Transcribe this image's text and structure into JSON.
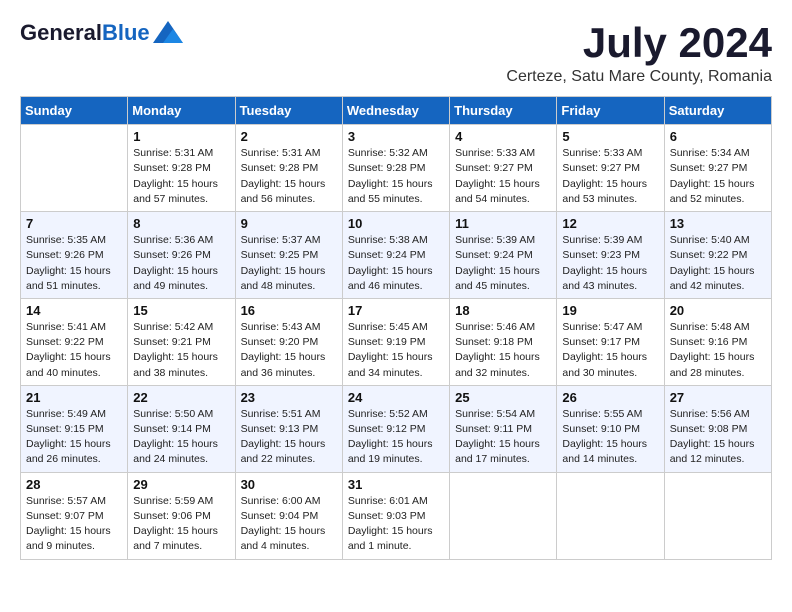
{
  "logo": {
    "general": "General",
    "blue": "Blue"
  },
  "title": {
    "month": "July 2024",
    "location": "Certeze, Satu Mare County, Romania"
  },
  "weekdays": [
    "Sunday",
    "Monday",
    "Tuesday",
    "Wednesday",
    "Thursday",
    "Friday",
    "Saturday"
  ],
  "weeks": [
    [
      {
        "day": "",
        "info": ""
      },
      {
        "day": "1",
        "info": "Sunrise: 5:31 AM\nSunset: 9:28 PM\nDaylight: 15 hours\nand 57 minutes."
      },
      {
        "day": "2",
        "info": "Sunrise: 5:31 AM\nSunset: 9:28 PM\nDaylight: 15 hours\nand 56 minutes."
      },
      {
        "day": "3",
        "info": "Sunrise: 5:32 AM\nSunset: 9:28 PM\nDaylight: 15 hours\nand 55 minutes."
      },
      {
        "day": "4",
        "info": "Sunrise: 5:33 AM\nSunset: 9:27 PM\nDaylight: 15 hours\nand 54 minutes."
      },
      {
        "day": "5",
        "info": "Sunrise: 5:33 AM\nSunset: 9:27 PM\nDaylight: 15 hours\nand 53 minutes."
      },
      {
        "day": "6",
        "info": "Sunrise: 5:34 AM\nSunset: 9:27 PM\nDaylight: 15 hours\nand 52 minutes."
      }
    ],
    [
      {
        "day": "7",
        "info": "Sunrise: 5:35 AM\nSunset: 9:26 PM\nDaylight: 15 hours\nand 51 minutes."
      },
      {
        "day": "8",
        "info": "Sunrise: 5:36 AM\nSunset: 9:26 PM\nDaylight: 15 hours\nand 49 minutes."
      },
      {
        "day": "9",
        "info": "Sunrise: 5:37 AM\nSunset: 9:25 PM\nDaylight: 15 hours\nand 48 minutes."
      },
      {
        "day": "10",
        "info": "Sunrise: 5:38 AM\nSunset: 9:24 PM\nDaylight: 15 hours\nand 46 minutes."
      },
      {
        "day": "11",
        "info": "Sunrise: 5:39 AM\nSunset: 9:24 PM\nDaylight: 15 hours\nand 45 minutes."
      },
      {
        "day": "12",
        "info": "Sunrise: 5:39 AM\nSunset: 9:23 PM\nDaylight: 15 hours\nand 43 minutes."
      },
      {
        "day": "13",
        "info": "Sunrise: 5:40 AM\nSunset: 9:22 PM\nDaylight: 15 hours\nand 42 minutes."
      }
    ],
    [
      {
        "day": "14",
        "info": "Sunrise: 5:41 AM\nSunset: 9:22 PM\nDaylight: 15 hours\nand 40 minutes."
      },
      {
        "day": "15",
        "info": "Sunrise: 5:42 AM\nSunset: 9:21 PM\nDaylight: 15 hours\nand 38 minutes."
      },
      {
        "day": "16",
        "info": "Sunrise: 5:43 AM\nSunset: 9:20 PM\nDaylight: 15 hours\nand 36 minutes."
      },
      {
        "day": "17",
        "info": "Sunrise: 5:45 AM\nSunset: 9:19 PM\nDaylight: 15 hours\nand 34 minutes."
      },
      {
        "day": "18",
        "info": "Sunrise: 5:46 AM\nSunset: 9:18 PM\nDaylight: 15 hours\nand 32 minutes."
      },
      {
        "day": "19",
        "info": "Sunrise: 5:47 AM\nSunset: 9:17 PM\nDaylight: 15 hours\nand 30 minutes."
      },
      {
        "day": "20",
        "info": "Sunrise: 5:48 AM\nSunset: 9:16 PM\nDaylight: 15 hours\nand 28 minutes."
      }
    ],
    [
      {
        "day": "21",
        "info": "Sunrise: 5:49 AM\nSunset: 9:15 PM\nDaylight: 15 hours\nand 26 minutes."
      },
      {
        "day": "22",
        "info": "Sunrise: 5:50 AM\nSunset: 9:14 PM\nDaylight: 15 hours\nand 24 minutes."
      },
      {
        "day": "23",
        "info": "Sunrise: 5:51 AM\nSunset: 9:13 PM\nDaylight: 15 hours\nand 22 minutes."
      },
      {
        "day": "24",
        "info": "Sunrise: 5:52 AM\nSunset: 9:12 PM\nDaylight: 15 hours\nand 19 minutes."
      },
      {
        "day": "25",
        "info": "Sunrise: 5:54 AM\nSunset: 9:11 PM\nDaylight: 15 hours\nand 17 minutes."
      },
      {
        "day": "26",
        "info": "Sunrise: 5:55 AM\nSunset: 9:10 PM\nDaylight: 15 hours\nand 14 minutes."
      },
      {
        "day": "27",
        "info": "Sunrise: 5:56 AM\nSunset: 9:08 PM\nDaylight: 15 hours\nand 12 minutes."
      }
    ],
    [
      {
        "day": "28",
        "info": "Sunrise: 5:57 AM\nSunset: 9:07 PM\nDaylight: 15 hours\nand 9 minutes."
      },
      {
        "day": "29",
        "info": "Sunrise: 5:59 AM\nSunset: 9:06 PM\nDaylight: 15 hours\nand 7 minutes."
      },
      {
        "day": "30",
        "info": "Sunrise: 6:00 AM\nSunset: 9:04 PM\nDaylight: 15 hours\nand 4 minutes."
      },
      {
        "day": "31",
        "info": "Sunrise: 6:01 AM\nSunset: 9:03 PM\nDaylight: 15 hours\nand 1 minute."
      },
      {
        "day": "",
        "info": ""
      },
      {
        "day": "",
        "info": ""
      },
      {
        "day": "",
        "info": ""
      }
    ]
  ]
}
